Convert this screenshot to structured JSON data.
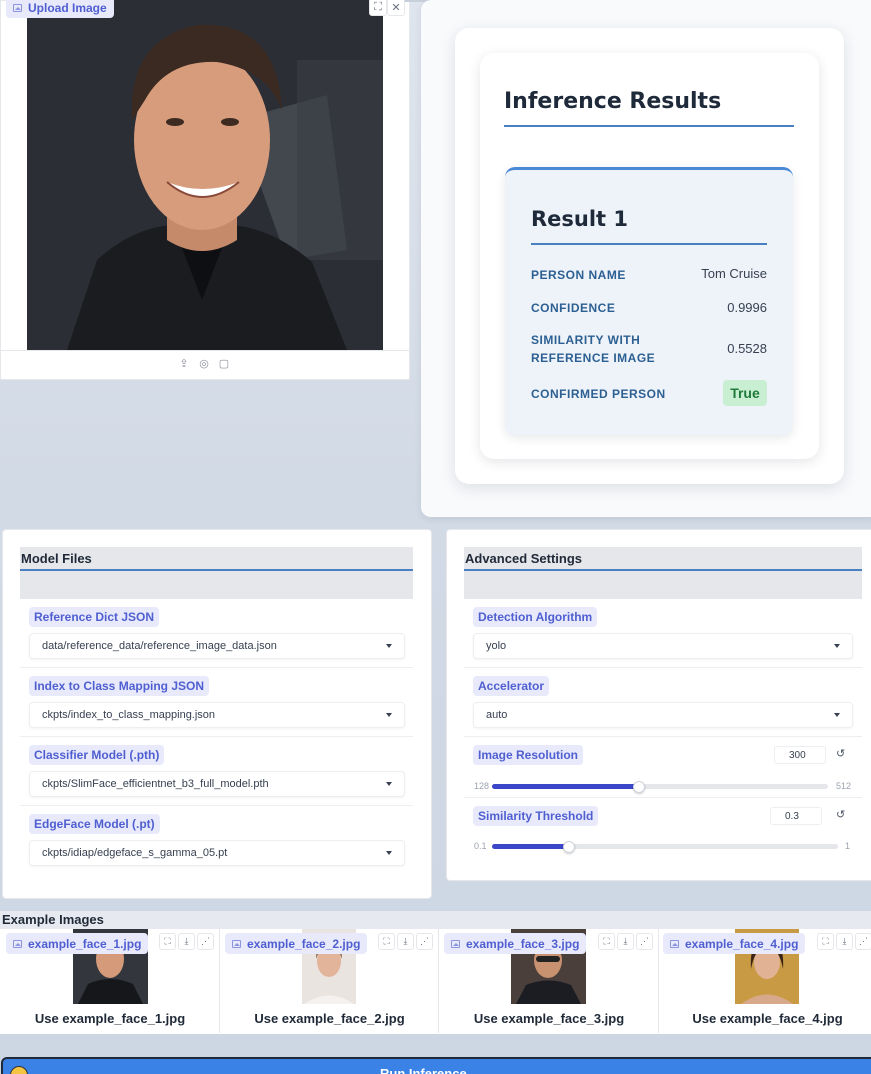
{
  "upload": {
    "label": "Upload Image"
  },
  "results": {
    "title": "Inference Results",
    "card_title": "Result 1",
    "rows": {
      "person_name_label": "PERSON NAME",
      "person_name_value": "Tom Cruise",
      "confidence_label": "CONFIDENCE",
      "confidence_value": "0.9996",
      "similarity_label": "SIMILARITY WITH REFERENCE IMAGE",
      "similarity_value": "0.5528",
      "confirmed_label": "CONFIRMED PERSON",
      "confirmed_value": "True"
    }
  },
  "model_files": {
    "title": "Model Files",
    "fields": [
      {
        "label": "Reference Dict JSON",
        "value": "data/reference_data/reference_image_data.json"
      },
      {
        "label": "Index to Class Mapping JSON",
        "value": "ckpts/index_to_class_mapping.json"
      },
      {
        "label": "Classifier Model (.pth)",
        "value": "ckpts/SlimFace_efficientnet_b3_full_model.pth"
      },
      {
        "label": "EdgeFace Model (.pt)",
        "value": "ckpts/idiap/edgeface_s_gamma_05.pt"
      }
    ]
  },
  "advanced": {
    "title": "Advanced Settings",
    "detection_label": "Detection Algorithm",
    "detection_value": "yolo",
    "accelerator_label": "Accelerator",
    "accelerator_value": "auto",
    "resolution": {
      "label": "Image Resolution",
      "value": "300",
      "min": "128",
      "max": "512",
      "fraction": 0.4375
    },
    "threshold": {
      "label": "Similarity Threshold",
      "value": "0.3",
      "min": "0.1",
      "max": "1",
      "fraction": 0.222
    }
  },
  "examples": {
    "title": "Example Images",
    "items": [
      {
        "file": "example_face_1.jpg",
        "caption": "Use example_face_1.jpg"
      },
      {
        "file": "example_face_2.jpg",
        "caption": "Use example_face_2.jpg"
      },
      {
        "file": "example_face_3.jpg",
        "caption": "Use example_face_3.jpg"
      },
      {
        "file": "example_face_4.jpg",
        "caption": "Use example_face_4.jpg"
      }
    ]
  },
  "run": {
    "label": "Run Inference"
  },
  "colors": {
    "accent": "#4a7fc1",
    "chip_text": "#4f5fd1",
    "slider_fill": "#3b47c9",
    "true_badge": "#c9efd3",
    "run_button": "#3b82e6"
  }
}
